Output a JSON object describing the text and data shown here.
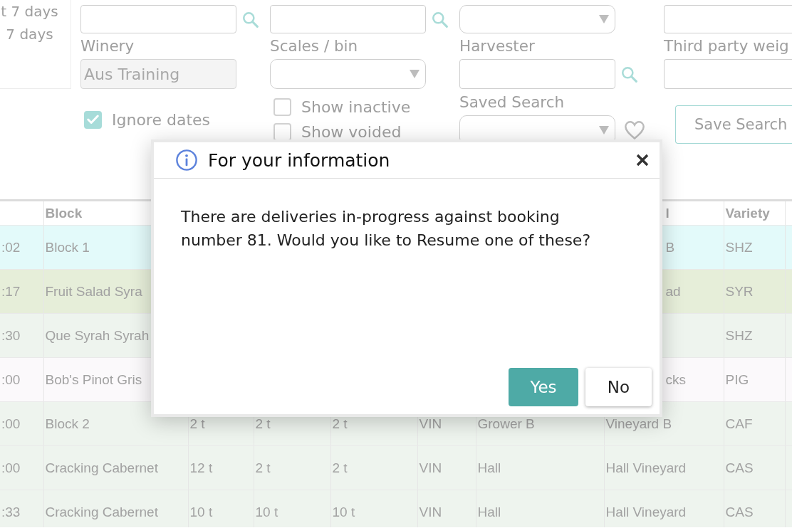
{
  "date_presets": [
    {
      "label": "t 7 days"
    },
    {
      "label": "7 days"
    }
  ],
  "filters": {
    "columns": [
      [
        {
          "kind": "search"
        },
        {
          "kind": "text",
          "label": "Winery",
          "value": "Aus Training",
          "disabled": true
        },
        {
          "kind": "checkbox",
          "label": "Ignore dates",
          "checked": true
        }
      ],
      [
        {
          "kind": "search"
        },
        {
          "kind": "select",
          "label": "Scales / bin"
        },
        {
          "kind": "checkbox",
          "label": "Show inactive",
          "checked": false
        },
        {
          "kind": "checkbox",
          "label": "Show voided",
          "checked": false
        }
      ],
      [
        {
          "kind": "select"
        },
        {
          "kind": "search",
          "label": "Harvester"
        },
        {
          "kind": "saved_search",
          "label": "Saved Search"
        }
      ],
      [
        {
          "kind": "text"
        },
        {
          "kind": "text",
          "label": "Third party weig"
        },
        {
          "kind": "button",
          "label": "Save Search"
        }
      ]
    ]
  },
  "table": {
    "columns": [
      null,
      "Block",
      null,
      null,
      null,
      null,
      null,
      "l",
      "Variety",
      null
    ],
    "rows": [
      {
        "color": "#e3fafa",
        "cells": [
          ":02",
          "Block 1",
          null,
          null,
          null,
          null,
          null,
          "B",
          "SHZ",
          null
        ]
      },
      {
        "color": "#e6eed9",
        "cells": [
          ":17",
          "Fruit Salad Syra",
          null,
          null,
          null,
          null,
          null,
          "ad",
          "SYR",
          null
        ]
      },
      {
        "color": "#eef4ee",
        "cells": [
          ":30",
          "Que Syrah Syrah",
          null,
          null,
          null,
          null,
          null,
          null,
          "SHZ",
          null
        ]
      },
      {
        "color": "#fbf9fb",
        "cells": [
          ":00",
          "Bob's Pinot Gris",
          null,
          null,
          null,
          null,
          null,
          "cks",
          "PIG",
          null
        ]
      },
      {
        "color": "#eef4ee",
        "cells": [
          ":00",
          "Block 2",
          "2 t",
          "2 t",
          "2 t",
          "VIN",
          "Grower B",
          "Vineyard B",
          "CAF",
          null
        ]
      },
      {
        "color": "#eef4ee",
        "cells": [
          ":00",
          "Cracking Cabernet",
          "12 t",
          "2 t",
          "2 t",
          "VIN",
          "Hall",
          "Hall Vineyard",
          "CAS",
          null
        ]
      },
      {
        "color": "#eef4ee",
        "cells": [
          ":33",
          "Cracking Cabernet",
          "10 t",
          "10 t",
          "10 t",
          "VIN",
          "Hall",
          "Hall Vineyard",
          "CAS",
          null
        ]
      }
    ]
  },
  "dialog": {
    "title": "For your information",
    "message": "There are deliveries in-progress against booking number 81. Would you like to Resume one of these?",
    "buttons": [
      {
        "label": "Yes",
        "kind": "primary"
      },
      {
        "label": "No",
        "kind": "secondary"
      }
    ]
  }
}
